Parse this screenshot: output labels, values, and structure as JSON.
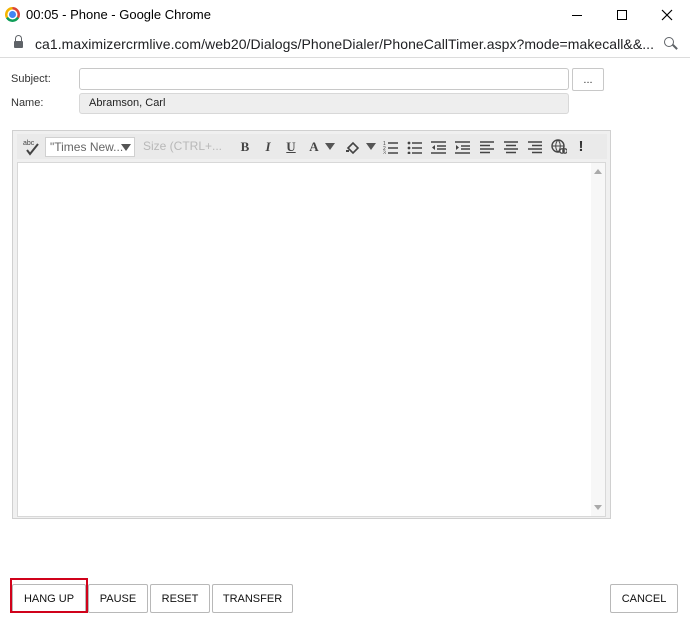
{
  "window": {
    "title": "00:05 - Phone - Google Chrome",
    "url": "ca1.maximizercrmlive.com/web20/Dialogs/PhoneDialer/PhoneCallTimer.aspx?mode=makecall&&..."
  },
  "form": {
    "subject_label": "Subject:",
    "subject_value": "",
    "ellipsis_label": "...",
    "name_label": "Name:",
    "name_value": "Abramson, Carl"
  },
  "editor": {
    "spellcheck_label": "abc",
    "font_value": "\"Times New...",
    "size_placeholder": "Size (CTRL+...",
    "bold": "B",
    "italic": "I",
    "underline": "U",
    "font_color": "A",
    "exclamation": "!"
  },
  "buttons": {
    "hang_up": "HANG UP",
    "pause": "PAUSE",
    "reset": "RESET",
    "transfer": "TRANSFER",
    "cancel": "CANCEL"
  },
  "colors": {
    "highlight": "#d0021b"
  }
}
